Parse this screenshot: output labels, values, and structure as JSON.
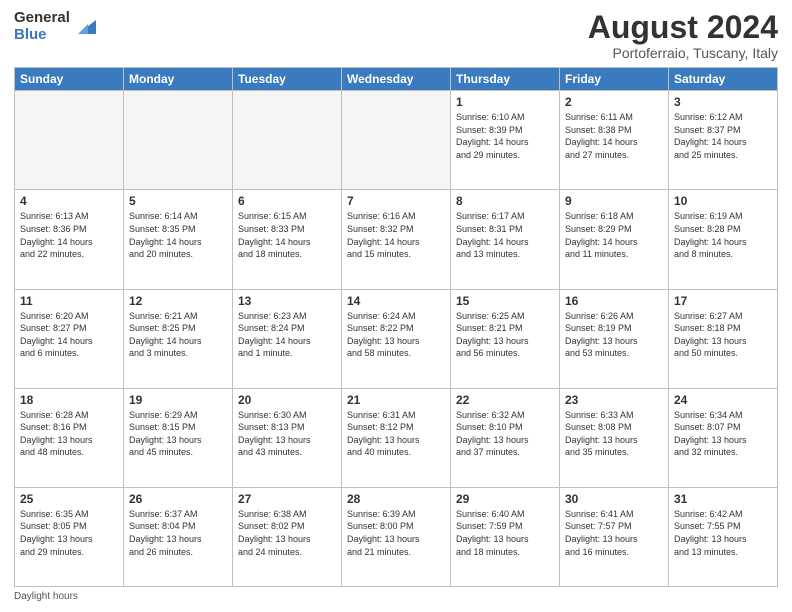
{
  "logo": {
    "general": "General",
    "blue": "Blue"
  },
  "header": {
    "month": "August 2024",
    "location": "Portoferraio, Tuscany, Italy"
  },
  "days_of_week": [
    "Sunday",
    "Monday",
    "Tuesday",
    "Wednesday",
    "Thursday",
    "Friday",
    "Saturday"
  ],
  "footer": "Daylight hours",
  "weeks": [
    [
      {
        "day": "",
        "info": ""
      },
      {
        "day": "",
        "info": ""
      },
      {
        "day": "",
        "info": ""
      },
      {
        "day": "",
        "info": ""
      },
      {
        "day": "1",
        "info": "Sunrise: 6:10 AM\nSunset: 8:39 PM\nDaylight: 14 hours\nand 29 minutes."
      },
      {
        "day": "2",
        "info": "Sunrise: 6:11 AM\nSunset: 8:38 PM\nDaylight: 14 hours\nand 27 minutes."
      },
      {
        "day": "3",
        "info": "Sunrise: 6:12 AM\nSunset: 8:37 PM\nDaylight: 14 hours\nand 25 minutes."
      }
    ],
    [
      {
        "day": "4",
        "info": "Sunrise: 6:13 AM\nSunset: 8:36 PM\nDaylight: 14 hours\nand 22 minutes."
      },
      {
        "day": "5",
        "info": "Sunrise: 6:14 AM\nSunset: 8:35 PM\nDaylight: 14 hours\nand 20 minutes."
      },
      {
        "day": "6",
        "info": "Sunrise: 6:15 AM\nSunset: 8:33 PM\nDaylight: 14 hours\nand 18 minutes."
      },
      {
        "day": "7",
        "info": "Sunrise: 6:16 AM\nSunset: 8:32 PM\nDaylight: 14 hours\nand 15 minutes."
      },
      {
        "day": "8",
        "info": "Sunrise: 6:17 AM\nSunset: 8:31 PM\nDaylight: 14 hours\nand 13 minutes."
      },
      {
        "day": "9",
        "info": "Sunrise: 6:18 AM\nSunset: 8:29 PM\nDaylight: 14 hours\nand 11 minutes."
      },
      {
        "day": "10",
        "info": "Sunrise: 6:19 AM\nSunset: 8:28 PM\nDaylight: 14 hours\nand 8 minutes."
      }
    ],
    [
      {
        "day": "11",
        "info": "Sunrise: 6:20 AM\nSunset: 8:27 PM\nDaylight: 14 hours\nand 6 minutes."
      },
      {
        "day": "12",
        "info": "Sunrise: 6:21 AM\nSunset: 8:25 PM\nDaylight: 14 hours\nand 3 minutes."
      },
      {
        "day": "13",
        "info": "Sunrise: 6:23 AM\nSunset: 8:24 PM\nDaylight: 14 hours\nand 1 minute."
      },
      {
        "day": "14",
        "info": "Sunrise: 6:24 AM\nSunset: 8:22 PM\nDaylight: 13 hours\nand 58 minutes."
      },
      {
        "day": "15",
        "info": "Sunrise: 6:25 AM\nSunset: 8:21 PM\nDaylight: 13 hours\nand 56 minutes."
      },
      {
        "day": "16",
        "info": "Sunrise: 6:26 AM\nSunset: 8:19 PM\nDaylight: 13 hours\nand 53 minutes."
      },
      {
        "day": "17",
        "info": "Sunrise: 6:27 AM\nSunset: 8:18 PM\nDaylight: 13 hours\nand 50 minutes."
      }
    ],
    [
      {
        "day": "18",
        "info": "Sunrise: 6:28 AM\nSunset: 8:16 PM\nDaylight: 13 hours\nand 48 minutes."
      },
      {
        "day": "19",
        "info": "Sunrise: 6:29 AM\nSunset: 8:15 PM\nDaylight: 13 hours\nand 45 minutes."
      },
      {
        "day": "20",
        "info": "Sunrise: 6:30 AM\nSunset: 8:13 PM\nDaylight: 13 hours\nand 43 minutes."
      },
      {
        "day": "21",
        "info": "Sunrise: 6:31 AM\nSunset: 8:12 PM\nDaylight: 13 hours\nand 40 minutes."
      },
      {
        "day": "22",
        "info": "Sunrise: 6:32 AM\nSunset: 8:10 PM\nDaylight: 13 hours\nand 37 minutes."
      },
      {
        "day": "23",
        "info": "Sunrise: 6:33 AM\nSunset: 8:08 PM\nDaylight: 13 hours\nand 35 minutes."
      },
      {
        "day": "24",
        "info": "Sunrise: 6:34 AM\nSunset: 8:07 PM\nDaylight: 13 hours\nand 32 minutes."
      }
    ],
    [
      {
        "day": "25",
        "info": "Sunrise: 6:35 AM\nSunset: 8:05 PM\nDaylight: 13 hours\nand 29 minutes."
      },
      {
        "day": "26",
        "info": "Sunrise: 6:37 AM\nSunset: 8:04 PM\nDaylight: 13 hours\nand 26 minutes."
      },
      {
        "day": "27",
        "info": "Sunrise: 6:38 AM\nSunset: 8:02 PM\nDaylight: 13 hours\nand 24 minutes."
      },
      {
        "day": "28",
        "info": "Sunrise: 6:39 AM\nSunset: 8:00 PM\nDaylight: 13 hours\nand 21 minutes."
      },
      {
        "day": "29",
        "info": "Sunrise: 6:40 AM\nSunset: 7:59 PM\nDaylight: 13 hours\nand 18 minutes."
      },
      {
        "day": "30",
        "info": "Sunrise: 6:41 AM\nSunset: 7:57 PM\nDaylight: 13 hours\nand 16 minutes."
      },
      {
        "day": "31",
        "info": "Sunrise: 6:42 AM\nSunset: 7:55 PM\nDaylight: 13 hours\nand 13 minutes."
      }
    ]
  ]
}
